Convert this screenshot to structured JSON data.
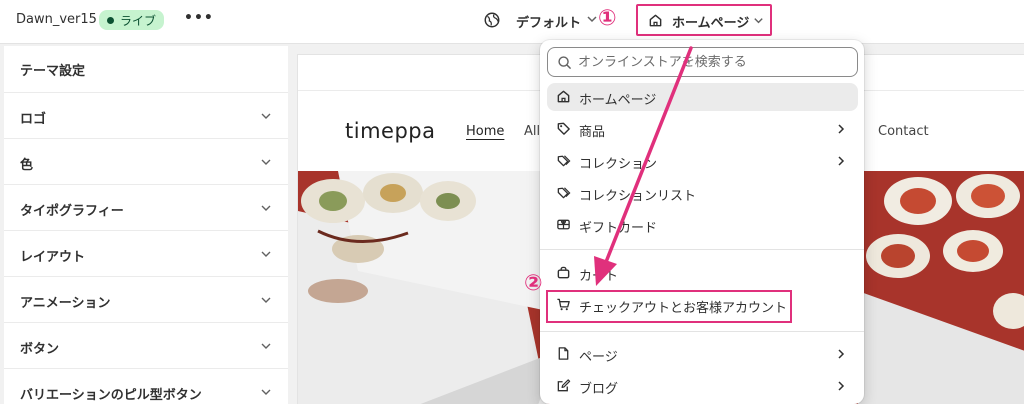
{
  "topbar": {
    "theme_name": "Dawn_ver15",
    "status_badge": "ライブ",
    "more_label": "•••",
    "language_label": "デフォルト",
    "page_selector_label": "ホームページ",
    "annotation_1": "①"
  },
  "sidebar": {
    "title": "テーマ設定",
    "items": [
      {
        "label": "ロゴ"
      },
      {
        "label": "色"
      },
      {
        "label": "タイポグラフィー"
      },
      {
        "label": "レイアウト"
      },
      {
        "label": "アニメーション"
      },
      {
        "label": "ボタン"
      },
      {
        "label": "バリエーションのピル型ボタン"
      }
    ]
  },
  "preview": {
    "store_name": "timeppa",
    "nav": {
      "home": "Home",
      "all": "All",
      "contact": "Contact"
    }
  },
  "dropdown": {
    "search_placeholder": "オンラインストアを検索する",
    "items": [
      {
        "label": "ホームページ",
        "icon": "home-icon",
        "active": true,
        "chevron": false
      },
      {
        "label": "商品",
        "icon": "tag-icon",
        "chevron": true
      },
      {
        "label": "コレクション",
        "icon": "collection-tag-icon",
        "chevron": true
      },
      {
        "label": "コレクションリスト",
        "icon": "collection-list-icon",
        "chevron": false
      },
      {
        "label": "ギフトカード",
        "icon": "gift-card-icon",
        "chevron": false
      },
      {
        "label": "カート",
        "icon": "bag-icon",
        "chevron": false
      },
      {
        "label": "チェックアウトとお客様アカウント",
        "icon": "cart-icon",
        "chevron": false
      },
      {
        "label": "ページ",
        "icon": "page-icon",
        "chevron": true
      },
      {
        "label": "ブログ",
        "icon": "blog-icon",
        "chevron": true
      }
    ],
    "annotation_2": "②"
  },
  "colors": {
    "accent_highlight": "#e0307c",
    "live_badge_bg": "#c6f3cf",
    "live_badge_text": "#0c5132"
  }
}
